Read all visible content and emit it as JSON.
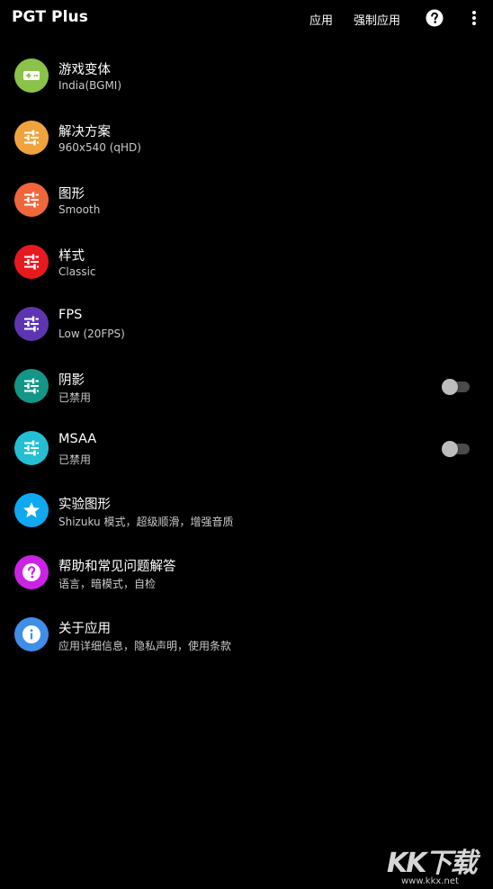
{
  "appbar": {
    "title": "PGT Plus",
    "apply_label": "应用",
    "force_apply_label": "强制应用",
    "help_icon": "help-circle-icon",
    "more_icon": "more-vert-icon"
  },
  "colors": {
    "background": "#000000",
    "text_primary": "#ffffff",
    "text_secondary": "#c9c9c9"
  },
  "items": [
    {
      "title": "游戏变体",
      "subtitle": "India(BGMI)",
      "icon": "gamepad-icon",
      "color": "#8bc34a"
    },
    {
      "title": "解决方案",
      "subtitle": "960x540 (qHD)",
      "icon": "tune-sliders-icon",
      "color": "#f0a33c"
    },
    {
      "title": "图形",
      "subtitle": "Smooth",
      "icon": "tune-sliders-icon",
      "color": "#f0663a"
    },
    {
      "title": "样式",
      "subtitle": "Classic",
      "icon": "tune-sliders-icon",
      "color": "#e8191f"
    },
    {
      "title": "FPS",
      "subtitle": "Low (20FPS)",
      "icon": "tune-sliders-icon",
      "color": "#5e35b1"
    },
    {
      "title": "阴影",
      "subtitle": "已禁用",
      "icon": "tune-sliders-icon",
      "color": "#139688",
      "toggle": false
    },
    {
      "title": "MSAA",
      "subtitle": "已禁用",
      "icon": "tune-sliders-icon",
      "color": "#24bfd3",
      "toggle": false
    },
    {
      "title": "实验图形",
      "subtitle": "Shizuku 模式，超级顺滑，增强音质",
      "icon": "star-icon",
      "color": "#10a8f0"
    },
    {
      "title": "帮助和常见问题解答",
      "subtitle": "语言，暗模式，自检",
      "icon": "help-circle-icon",
      "color": "#cc22e6"
    },
    {
      "title": "关于应用",
      "subtitle": "应用详细信息，隐私声明，使用条款",
      "icon": "info-icon",
      "color": "#3f8ee8"
    }
  ],
  "watermark": {
    "logo": "KK下载",
    "url": "www.kkx.net"
  }
}
